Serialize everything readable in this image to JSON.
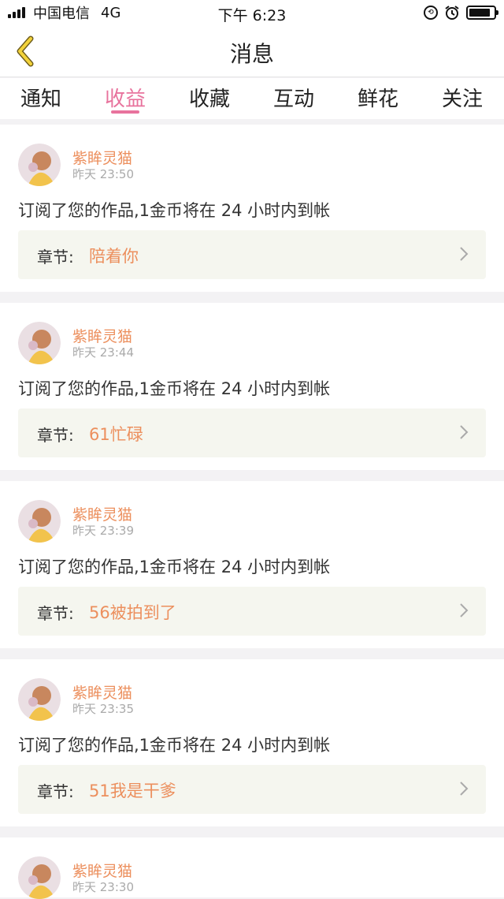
{
  "status_bar": {
    "carrier": "中国电信",
    "network": "4G",
    "time": "下午 6:23"
  },
  "navbar": {
    "title": "消息",
    "back_icon": "chevron-left-icon"
  },
  "tabs": [
    {
      "label": "通知",
      "active": false
    },
    {
      "label": "收益",
      "active": true
    },
    {
      "label": "收藏",
      "active": false
    },
    {
      "label": "互动",
      "active": false
    },
    {
      "label": "鲜花",
      "active": false
    },
    {
      "label": "关注",
      "active": false
    }
  ],
  "colors": {
    "accent": "#e8739d",
    "name": "#ec8f5d"
  },
  "messages": [
    {
      "user": "紫眸灵猫",
      "time": "昨天 23:50",
      "text": "订阅了您的作品,1金币将在 24 小时内到帐",
      "chapter_label": "章节:",
      "chapter": "陪着你"
    },
    {
      "user": "紫眸灵猫",
      "time": "昨天 23:44",
      "text": "订阅了您的作品,1金币将在 24 小时内到帐",
      "chapter_label": "章节:",
      "chapter": "61忙碌"
    },
    {
      "user": "紫眸灵猫",
      "time": "昨天 23:39",
      "text": "订阅了您的作品,1金币将在 24 小时内到帐",
      "chapter_label": "章节:",
      "chapter": "56被拍到了"
    },
    {
      "user": "紫眸灵猫",
      "time": "昨天 23:35",
      "text": "订阅了您的作品,1金币将在 24 小时内到帐",
      "chapter_label": "章节:",
      "chapter": "51我是干爹"
    },
    {
      "user": "紫眸灵猫",
      "time": "昨天 23:30"
    }
  ]
}
